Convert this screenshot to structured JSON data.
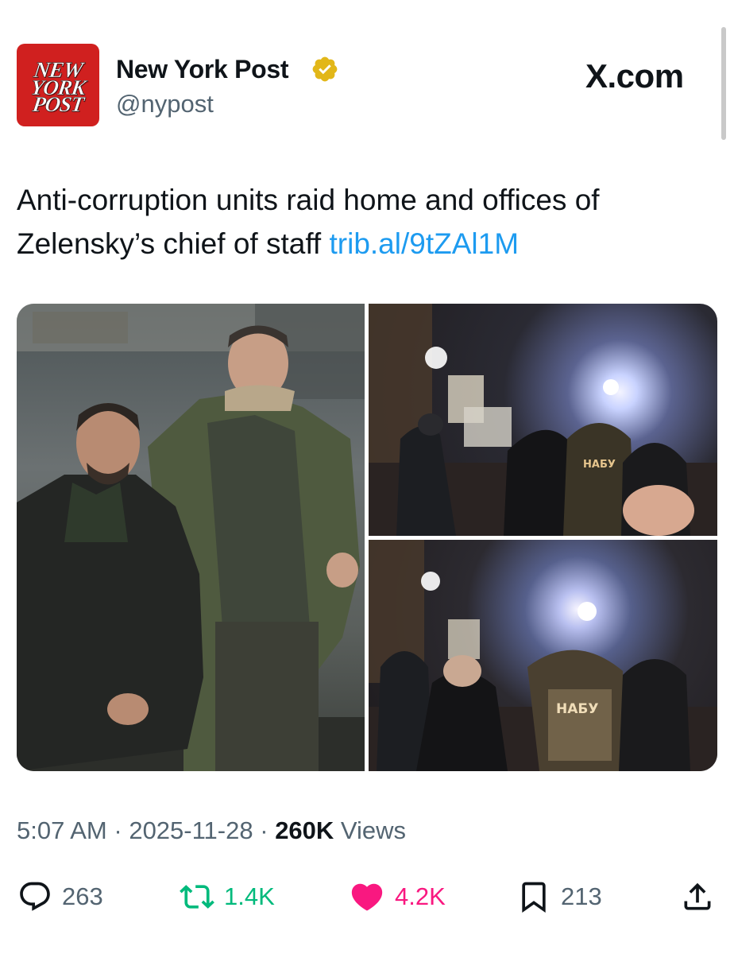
{
  "author": {
    "avatar_text": [
      "NEW",
      "YORK",
      "POST"
    ],
    "display_name": "New York Post",
    "handle": "@nypost",
    "verified": true
  },
  "brand": "X.com",
  "tweet": {
    "text": "Anti-corruption units raid home and offices of Zelensky’s chief of staff",
    "link": "trib.al/9tZAl1M"
  },
  "media": {
    "photos": [
      {
        "label": ""
      },
      {
        "label": "НАБУ"
      },
      {
        "label": "НАБУ"
      }
    ]
  },
  "meta": {
    "time": "5:07 AM",
    "date": "2025-11-28",
    "views_count": "260K",
    "views_label": "Views",
    "separator": "·"
  },
  "actions": {
    "replies": "263",
    "reposts": "1.4K",
    "likes": "4.2K",
    "bookmarks": "213"
  },
  "colors": {
    "link": "#1d9bf0",
    "repost": "#00ba7c",
    "like": "#f91880",
    "muted": "#536471",
    "avatar_bg": "#d0201f",
    "verified_gold": "#e2b719"
  },
  "icons": [
    "verified-badge-icon",
    "reply-icon",
    "repost-icon",
    "heart-icon",
    "bookmark-icon",
    "share-icon"
  ]
}
